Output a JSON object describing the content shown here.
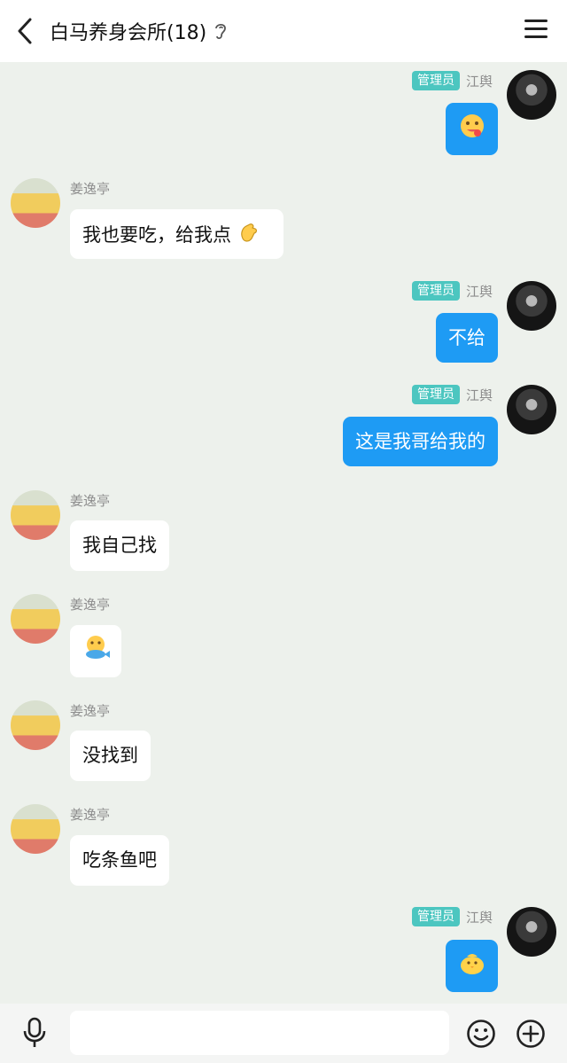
{
  "header": {
    "title": "白马养身会所(18)",
    "back_icon": "chevron-left-icon",
    "ear_icon": "ear-icon",
    "menu_icon": "menu-icon"
  },
  "users": {
    "admin": {
      "name": "江舆",
      "badge": "管理员"
    },
    "member": {
      "name": "姜逸亭"
    }
  },
  "messages": [
    {
      "side": "right",
      "sender": "江舆",
      "badge": "管理员",
      "content": "",
      "emoji": "drooling-face-icon"
    },
    {
      "side": "left",
      "sender": "姜逸亭",
      "content": "我也要吃，给我点",
      "emoji": "pinching-hand-icon"
    },
    {
      "side": "right",
      "sender": "江舆",
      "badge": "管理员",
      "content": "不给"
    },
    {
      "side": "right",
      "sender": "江舆",
      "badge": "管理员",
      "content": "这是我哥给我的"
    },
    {
      "side": "left",
      "sender": "姜逸亭",
      "content": "我自己找"
    },
    {
      "side": "left",
      "sender": "姜逸亭",
      "content": "",
      "emoji": "fish-eating-icon"
    },
    {
      "side": "left",
      "sender": "姜逸亭",
      "content": "没找到"
    },
    {
      "side": "left",
      "sender": "姜逸亭",
      "content": "吃条鱼吧"
    },
    {
      "side": "right",
      "sender": "江舆",
      "badge": "管理员",
      "content": "",
      "emoji": "chick-icon"
    }
  ],
  "footer": {
    "mic_icon": "microphone-icon",
    "input_placeholder": "",
    "emoji_icon": "smile-icon",
    "plus_icon": "plus-circle-icon"
  },
  "colors": {
    "background": "#edf1ec",
    "sent_bubble": "#1e9bf4",
    "received_bubble": "#ffffff",
    "badge": "#4cc6c0"
  }
}
